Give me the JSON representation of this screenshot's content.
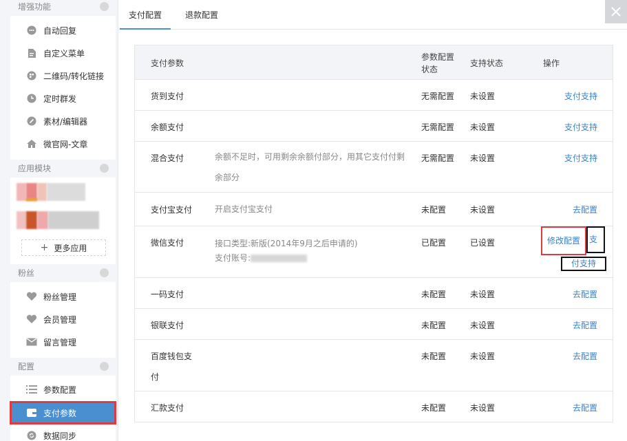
{
  "sidebar": {
    "sections": [
      {
        "label": "增强功能"
      },
      {
        "label": "应用模块"
      },
      {
        "label": "粉丝"
      },
      {
        "label": "配置"
      }
    ],
    "enhance_items": [
      {
        "label": "自动回复",
        "icon": "chat-bubble-icon"
      },
      {
        "label": "自定义菜单",
        "icon": "document-edit-icon"
      },
      {
        "label": "二维码/转化链接",
        "icon": "qrcode-icon"
      },
      {
        "label": "定时群发",
        "icon": "clock-icon"
      },
      {
        "label": "素材/编辑器",
        "icon": "pencil-icon"
      },
      {
        "label": "微官网-文章",
        "icon": "home-icon"
      }
    ],
    "more_apps": "更多应用",
    "fans_items": [
      {
        "label": "粉丝管理",
        "icon": "heart-icon"
      },
      {
        "label": "会员管理",
        "icon": "heart-icon"
      },
      {
        "label": "留言管理",
        "icon": "envelope-icon"
      }
    ],
    "config_items": [
      {
        "label": "参数配置",
        "icon": "list-icon"
      },
      {
        "label": "支付参数",
        "icon": "wallet-icon"
      },
      {
        "label": "数据同步",
        "icon": "sync-icon"
      }
    ]
  },
  "tabs": [
    {
      "label": "支付配置",
      "active": true
    },
    {
      "label": "退款配置",
      "active": false
    }
  ],
  "table": {
    "headers": {
      "name": "支付参数",
      "config_status_line1": "参数配置",
      "config_status_line2": "状态",
      "support_status": "支持状态",
      "action": "操作"
    },
    "rows": [
      {
        "name": "货到支付",
        "desc": "",
        "config": "无需配置",
        "support": "未设置",
        "action": "支付支持"
      },
      {
        "name": "余额支付",
        "desc": "",
        "config": "无需配置",
        "support": "未设置",
        "action": "支付支持"
      },
      {
        "name": "混合支付",
        "desc1": "余额不足时，可用剩余余额付部分，用其它支付付剩",
        "desc2": "余部分",
        "config": "无需配置",
        "support": "未设置",
        "action": "支付支持"
      },
      {
        "name": "支付宝支付",
        "desc": "开启支付宝支付",
        "config": "未配置",
        "support": "未设置",
        "action": "去配置"
      },
      {
        "name": "微信支付",
        "desc1": "接口类型:新版(2014年9月之后申请的)",
        "desc2": "支付账号:",
        "config": "已配置",
        "support": "已设置",
        "action_modify": "修改配置",
        "action_support_a": "支",
        "action_support_b": "付支持"
      },
      {
        "name": "一码支付",
        "desc": "",
        "config": "未配置",
        "support": "未设置",
        "action": "去配置"
      },
      {
        "name": "银联支付",
        "desc": "",
        "config": "未配置",
        "support": "未设置",
        "action": "去配置"
      },
      {
        "name1": "百度钱包支",
        "name2": "付",
        "desc": "",
        "config": "未配置",
        "support": "未设置",
        "action": "去配置"
      },
      {
        "name": "汇款支付",
        "desc": "",
        "config": "未配置",
        "support": "未设置",
        "action": "去配置"
      }
    ]
  },
  "colors": {
    "accent": "#4a90d0",
    "link": "#3b83c8",
    "highlight": "#e0393e"
  }
}
